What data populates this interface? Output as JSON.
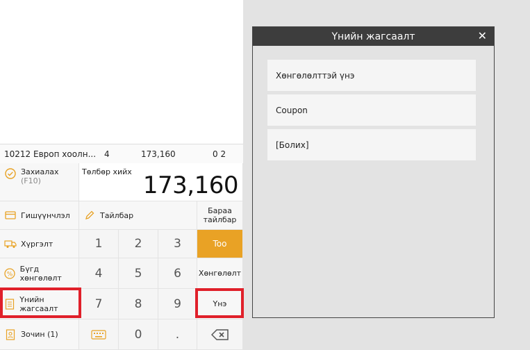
{
  "order_row": {
    "name": "10212 Европ хоолн...",
    "qty": "4",
    "amount": "173,160",
    "extra": "0  2"
  },
  "pad": {
    "order_label": "Захиалах",
    "order_key": "(F10)",
    "pay_label": "Төлбөр хийх",
    "pay_amount": "173,160",
    "member": "Гишүүнчлэл",
    "note": "Тайлбар",
    "item_note": "Бараа тайлбар",
    "delivery": "Хүргэлт",
    "qty_btn": "Too",
    "full_discount": "Бүгд хөнгөлөлт",
    "discount": "Хөнгөлөлт",
    "price_discount": "Үнийн жагсаалт",
    "price": "Үнэ",
    "guest": "Зочин (1)",
    "digits": [
      "1",
      "2",
      "3",
      "4",
      "5",
      "6",
      "7",
      "8",
      "9",
      "0",
      "."
    ]
  },
  "dialog": {
    "title": "Үнийн жагсаалт",
    "options": [
      "Хөнгөлөлттэй үнэ",
      "Coupon",
      "[Болих]"
    ]
  },
  "colors": {
    "accent": "#e9a225",
    "highlight": "#e0202a",
    "dialog_header": "#3d3d3d"
  }
}
